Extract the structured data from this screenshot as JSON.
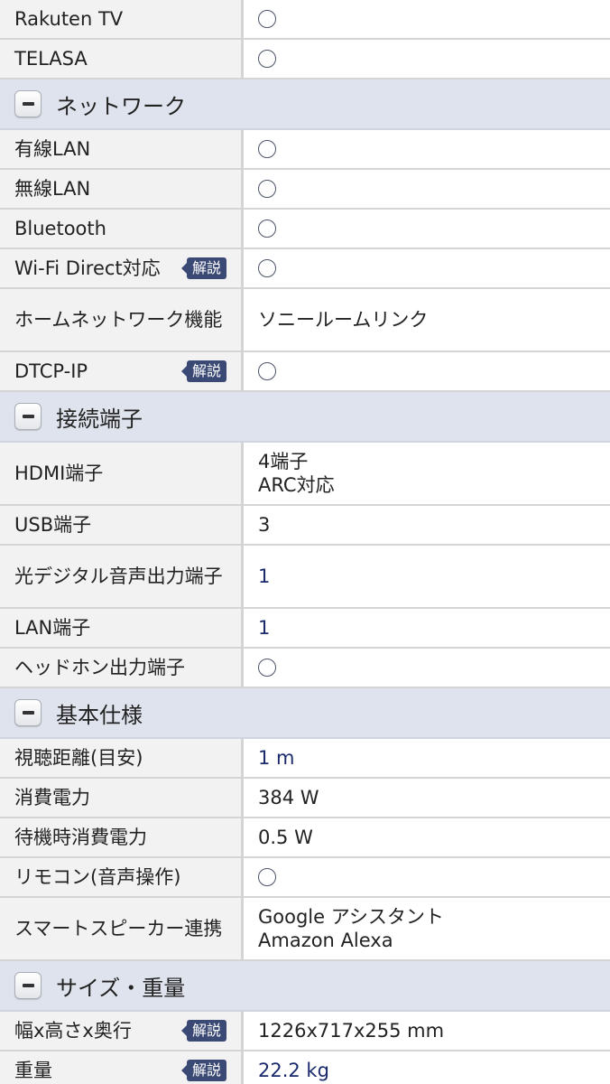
{
  "badge_label": "解説",
  "colors": {
    "section_bg": "#dfe3ed",
    "label_bg": "#f2f2f2",
    "badge_bg": "#3b4a75",
    "link_text": "#1a2a6c"
  },
  "top_rows": [
    {
      "label": "Rakuten TV",
      "value": "○"
    },
    {
      "label": "TELASA",
      "value": "○"
    }
  ],
  "sections": [
    {
      "title": "ネットワーク",
      "rows": [
        {
          "label": "有線LAN",
          "value": "○"
        },
        {
          "label": "無線LAN",
          "value": "○"
        },
        {
          "label": "Bluetooth",
          "value": "○"
        },
        {
          "label": "Wi-Fi Direct対応",
          "value": "○",
          "badge": true
        },
        {
          "label": "ホームネットワーク機能",
          "value": "ソニールームリンク"
        },
        {
          "label": "DTCP-IP",
          "value": "○",
          "badge": true
        }
      ]
    },
    {
      "title": "接続端子",
      "rows": [
        {
          "label": "HDMI端子",
          "value": [
            "4端子",
            "ARC対応"
          ]
        },
        {
          "label": "USB端子",
          "value": "3"
        },
        {
          "label": "光デジタル音声出力端子",
          "value": "1",
          "link": true
        },
        {
          "label": "LAN端子",
          "value": "1",
          "link": true
        },
        {
          "label": "ヘッドホン出力端子",
          "value": "○"
        }
      ]
    },
    {
      "title": "基本仕様",
      "rows": [
        {
          "label": "視聴距離(目安)",
          "value": "1 m",
          "link": true
        },
        {
          "label": "消費電力",
          "value": "384 W"
        },
        {
          "label": "待機時消費電力",
          "value": "0.5 W"
        },
        {
          "label": "リモコン(音声操作)",
          "value": "○"
        },
        {
          "label": "スマートスピーカー連携",
          "value": [
            "Google アシスタント",
            "Amazon Alexa"
          ]
        }
      ]
    },
    {
      "title": "サイズ・重量",
      "rows": [
        {
          "label": "幅x高さx奥行",
          "value": "1226x717x255 mm",
          "badge": true
        },
        {
          "label": "重量",
          "value": "22.2 kg",
          "badge": true,
          "link": true
        }
      ]
    }
  ]
}
